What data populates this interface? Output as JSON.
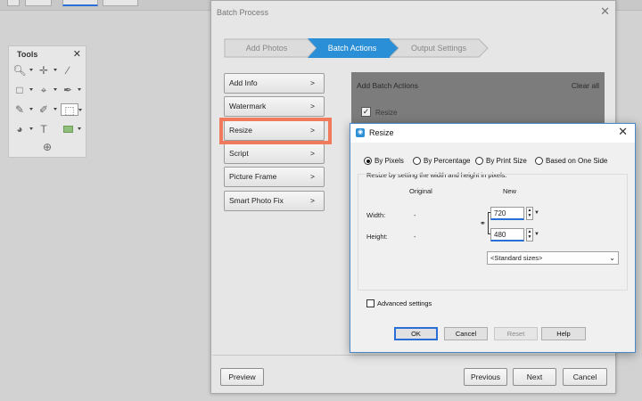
{
  "tools_panel": {
    "title": "Tools",
    "close_glyph": "✕",
    "icons": [
      "zoom-icon",
      "move-icon",
      "eyedropper-icon",
      "marquee-icon",
      "transform-icon",
      "brush-icon",
      "pencil-icon",
      "smudge-icon",
      "selection-brush-icon",
      "quick-selection-icon",
      "type-icon",
      "shape-icon",
      "add-tool-icon"
    ]
  },
  "batch_window": {
    "title": "Batch Process",
    "close_glyph": "✕",
    "steps": [
      {
        "label": "Add Photos",
        "active": false
      },
      {
        "label": "Batch Actions",
        "active": true
      },
      {
        "label": "Output Settings",
        "active": false
      }
    ],
    "actions": [
      {
        "label": "Add Info",
        "arrow": ">"
      },
      {
        "label": "Watermark",
        "arrow": ">"
      },
      {
        "label": "Resize",
        "arrow": ">"
      },
      {
        "label": "Script",
        "arrow": ">"
      },
      {
        "label": "Picture Frame",
        "arrow": ">"
      },
      {
        "label": "Smart Photo Fix",
        "arrow": ">"
      }
    ],
    "panel": {
      "header": "Add Batch Actions",
      "clear_all": "Clear all",
      "resize_checked": true,
      "resize_label": "Resize"
    },
    "buttons": {
      "preview": "Preview",
      "previous": "Previous",
      "next": "Next",
      "cancel": "Cancel"
    }
  },
  "resize_dialog": {
    "title": "Resize",
    "close_glyph": "✕",
    "modes": [
      {
        "label": "By Pixels",
        "selected": true
      },
      {
        "label": "By Percentage",
        "selected": false
      },
      {
        "label": "By Print Size",
        "selected": false
      },
      {
        "label": "Based on One Side",
        "selected": false
      }
    ],
    "instruction": "Resize by setting the width and height in pixels.",
    "original_header": "Original",
    "new_header": "New",
    "width_label": "Width:",
    "height_label": "Height:",
    "original_width": "-",
    "original_height": "-",
    "new_width": "720",
    "new_height": "480",
    "standard_sizes": "<Standard sizes>",
    "advanced_settings": "Advanced settings",
    "buttons": {
      "ok": "OK",
      "cancel": "Cancel",
      "reset": "Reset",
      "help": "Help"
    }
  },
  "colors": {
    "highlight": "#ef7a5c",
    "active_step": "#2a8fd6",
    "accent": "#2a6fd6"
  }
}
